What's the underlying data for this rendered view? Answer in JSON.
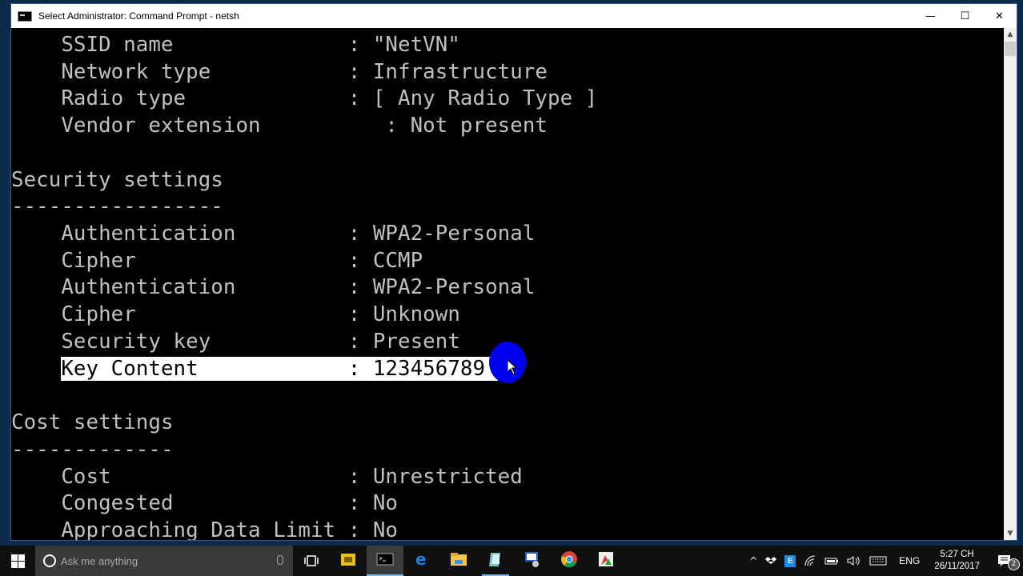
{
  "window": {
    "title": "Select Administrator: Command Prompt - netsh",
    "buttons": {
      "minimize": "—",
      "maximize": "☐",
      "close": "✕"
    }
  },
  "console": {
    "lines": [
      "    SSID name              : \"NetVN\"",
      "    Network type           : Infrastructure",
      "    Radio type             : [ Any Radio Type ]",
      "    Vendor extension          : Not present",
      "",
      "Security settings",
      "-----------------",
      "    Authentication         : WPA2-Personal",
      "    Cipher                 : CCMP",
      "    Authentication         : WPA2-Personal",
      "    Cipher                 : Unknown",
      "    Security key           : Present",
      "    Key Content            : 123456789",
      "",
      "Cost settings",
      "-------------",
      "    Cost                   : Unrestricted",
      "    Congested              : No",
      "    Approaching Data Limit : No"
    ],
    "selected_text": "Key Content            : 123456789 ",
    "selected_line_index": 12
  },
  "scrollbar": {
    "up": "▲",
    "down": "▼"
  },
  "taskbar": {
    "search_placeholder": "Ask me anything",
    "apps": [
      {
        "name": "file-manager-app",
        "label": "Files"
      },
      {
        "name": "command-prompt-app",
        "label": "Command Prompt",
        "state": "active"
      },
      {
        "name": "edge-browser-app",
        "label": "Microsoft Edge"
      },
      {
        "name": "file-explorer-app",
        "label": "File Explorer"
      },
      {
        "name": "notepad-app",
        "label": "App"
      },
      {
        "name": "remote-desktop-app",
        "label": "Remote Desktop"
      },
      {
        "name": "chrome-app",
        "label": "Google Chrome"
      },
      {
        "name": "media-app",
        "label": "App"
      }
    ],
    "tray": {
      "chevron": "^",
      "language": "ENG",
      "time": "5:27 CH",
      "date": "26/11/2017",
      "notification_count": "2"
    }
  }
}
